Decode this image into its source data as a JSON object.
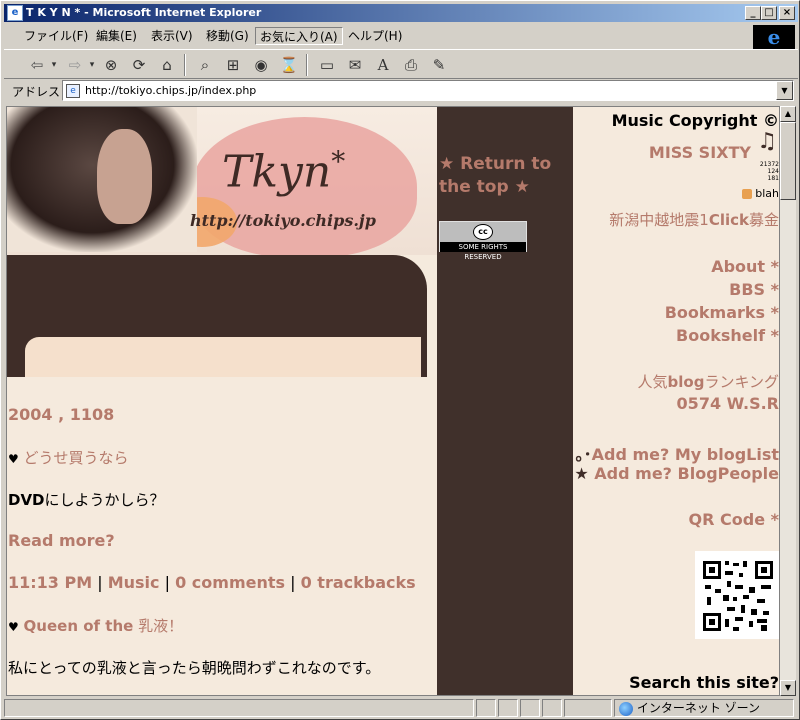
{
  "window": {
    "title": "T K Y N * - Microsoft Internet Explorer",
    "controls": {
      "minimize": "_",
      "maximize": "□",
      "close": "×"
    }
  },
  "menubar": {
    "items": [
      "ファイル(F)",
      "編集(E)",
      "表示(V)",
      "移動(G)",
      "お気に入り(A)",
      "ヘルプ(H)"
    ]
  },
  "toolbar": {
    "icons": [
      "back-icon",
      "forward-icon",
      "stop-icon",
      "refresh-icon",
      "home-icon",
      "search-icon",
      "favorites-icon",
      "media-icon",
      "history-icon",
      "fullscreen-icon",
      "mail-icon",
      "font-icon",
      "print-icon",
      "edit-icon"
    ],
    "glyphs": {
      "back": "⇦",
      "forward": "⇨",
      "dropdown": "▾",
      "stop": "⊗",
      "refresh": "⟳",
      "home": "⌂",
      "search": "⌕",
      "favorites": "⊞",
      "media": "◉",
      "history": "⌛",
      "fullscreen": "▭",
      "mail": "✉",
      "font": "A",
      "print": "⎙",
      "edit": "✎"
    }
  },
  "address": {
    "label": "アドレス",
    "url": "http://tokiyo.chips.jp/index.php"
  },
  "header": {
    "title": "Tkyn",
    "title_mark": "*",
    "url": "http://tokiyo.chips.jp"
  },
  "posts": [
    {
      "date": "2004 , 1108",
      "title": "どうせ買うなら",
      "body_bold": "DVD",
      "body": "にしようかしら？",
      "read_more": "Read more?",
      "time": "11:13 PM",
      "category": "Music",
      "comments": "0 comments",
      "trackbacks": "0 trackbacks"
    },
    {
      "title_bold": "Queen of the",
      "title_rest": "乳液！",
      "body": "私にとっての乳液と言ったら朝晩問わずこれなのです。"
    }
  ],
  "sidebar_mid": {
    "return_to_top": "★ Return to the top ★",
    "cc_badge": "SOME RIGHTS RESERVED",
    "cc_logo": "cc"
  },
  "sidebar_right": {
    "music_copyright": "Music Copyright ©",
    "music_note": "♫",
    "artist": "MISS SIXTY",
    "counter": "21372\n124\n181",
    "blah": "blah",
    "donation_pre": "新潟中越地震1",
    "donation_bold": "Click",
    "donation_post": "募金",
    "links": [
      "About *",
      "BBS *",
      "Bookmarks *",
      "Bookshelf *"
    ],
    "ranking_pre": "人気",
    "ranking_bold": "blog",
    "ranking_post": "ランキング",
    "wsr": "0574 W.S.R",
    "add_mylist": "Add me? My blogList",
    "add_mylist_prefix": "｡･",
    "add_blogpeople": "Add me? BlogPeople",
    "add_blogpeople_prefix": "★",
    "qr_code": "QR Code *",
    "search": "Search this site?"
  },
  "status": {
    "zone": "インターネット ゾーン"
  },
  "colors": {
    "accent_pink": "#b57a6b",
    "dark_brown": "#40302b",
    "page_bg": "#f5eadd",
    "title_bar": "#0a246a"
  }
}
